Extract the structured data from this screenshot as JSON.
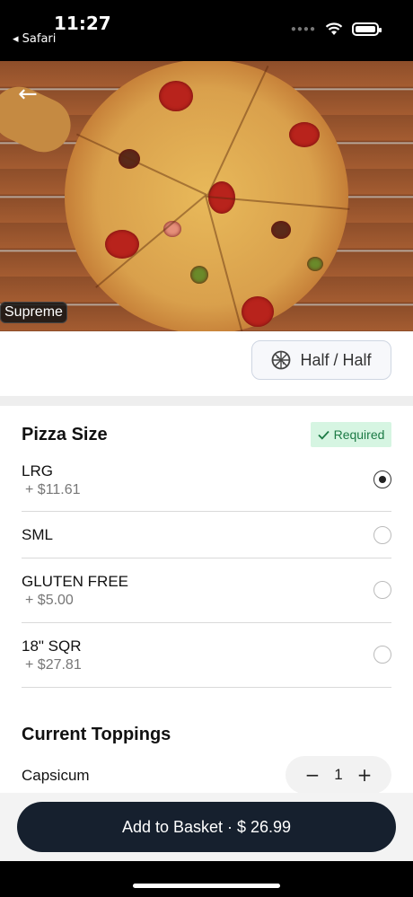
{
  "status_bar": {
    "time": "11:27",
    "back_label": "◂ Safari"
  },
  "hero": {
    "product_name": "Supreme"
  },
  "half_half": {
    "label": "Half / Half"
  },
  "pizza_size": {
    "title": "Pizza Size",
    "required_label": "Required",
    "options": [
      {
        "name": "LRG",
        "price": "+ $11.61",
        "selected": true
      },
      {
        "name": "SML",
        "price": "",
        "selected": false
      },
      {
        "name": "GLUTEN FREE",
        "price": "+ $5.00",
        "selected": false
      },
      {
        "name": "18\" SQR",
        "price": "+ $27.81",
        "selected": false
      }
    ]
  },
  "toppings": {
    "title": "Current Toppings",
    "items": [
      {
        "name": "Capsicum",
        "quantity": "1"
      }
    ]
  },
  "basket": {
    "label": "Add to Basket · $ 26.99"
  },
  "colors": {
    "primary_button": "#16202e",
    "required_bg": "#d6f5e2",
    "required_text": "#1c7a45"
  }
}
